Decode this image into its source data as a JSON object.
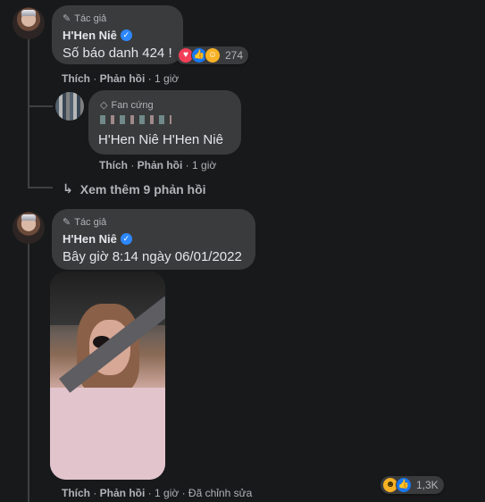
{
  "comment1": {
    "role": "Tác giả",
    "author": "H'Hen Niê",
    "text": "Số báo danh 424 !",
    "reaction_count": "274",
    "actions": {
      "like": "Thích",
      "reply": "Phản hồi",
      "time": "1 giờ"
    }
  },
  "reply1": {
    "badge": "Fan cứng",
    "text": "H'Hen Niê H'Hen Niê",
    "actions": {
      "like": "Thích",
      "reply": "Phản hồi",
      "time": "1 giờ"
    }
  },
  "more_replies": "Xem thêm 9 phản hồi",
  "comment2": {
    "role": "Tác giả",
    "author": "H'Hen Niê",
    "text": "Bây giờ 8:14 ngày 06/01/2022",
    "reaction_count": "1,3K",
    "actions": {
      "like": "Thích",
      "reply": "Phản hồi",
      "time": "1 giờ",
      "edited": "Đã chỉnh sửa"
    }
  },
  "colors": {
    "background": "#18191a",
    "bubble": "#3a3b3c",
    "verified": "#2d88ff",
    "muted": "#b0b3b8"
  }
}
